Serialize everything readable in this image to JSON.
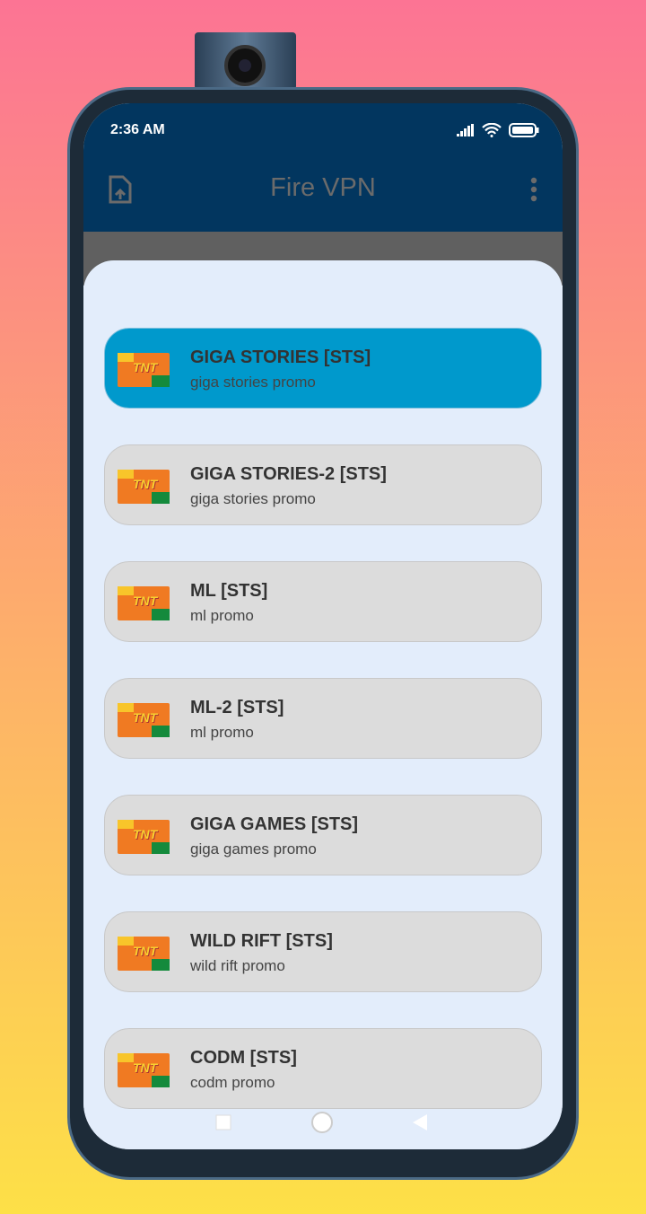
{
  "status": {
    "time": "2:36 AM"
  },
  "app": {
    "title": "Fire VPN"
  },
  "servers": [
    {
      "name": "GIGA STORIES [STS]",
      "desc": "giga stories promo",
      "selected": true
    },
    {
      "name": "GIGA STORIES-2 [STS]",
      "desc": "giga stories promo"
    },
    {
      "name": "ML [STS]",
      "desc": "ml promo"
    },
    {
      "name": "ML-2 [STS]",
      "desc": "ml promo"
    },
    {
      "name": "GIGA GAMES [STS]",
      "desc": "giga games promo"
    },
    {
      "name": "WILD RIFT [STS]",
      "desc": "wild rift promo"
    },
    {
      "name": "CODM [STS]",
      "desc": "codm promo"
    }
  ],
  "logo_text": "TNT",
  "colors": {
    "appbar": "#02365f",
    "selected": "#0099cc",
    "item": "#dcdcdc"
  }
}
